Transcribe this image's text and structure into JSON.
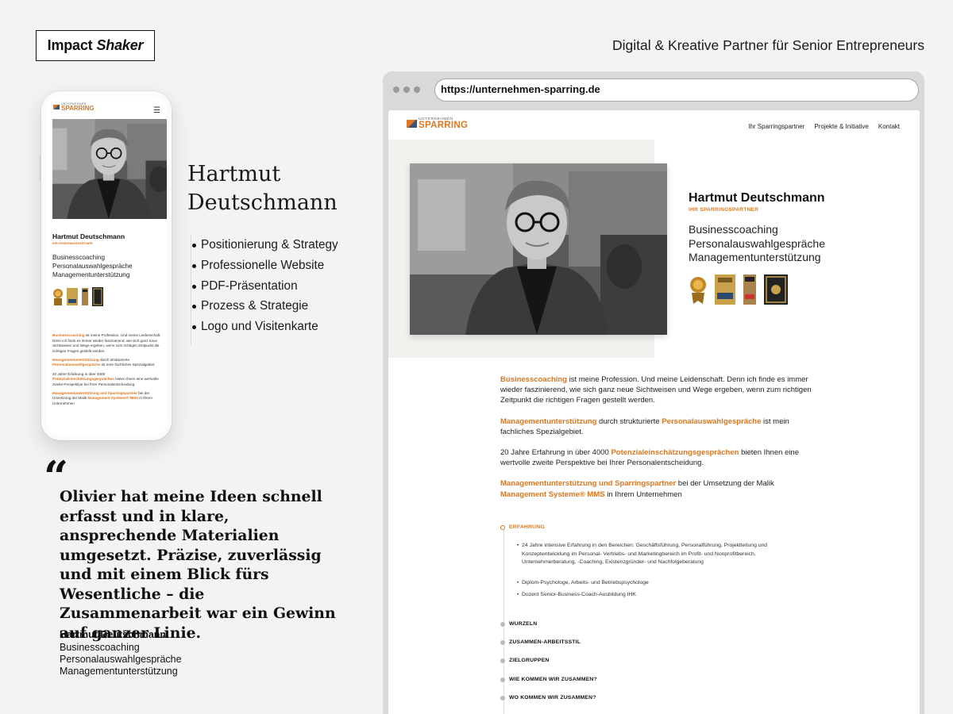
{
  "brand": {
    "name_regular": "Impact",
    "name_italic": "Shaker"
  },
  "tagline": "Digital & Kreative Partner für Senior Entrepreneurs",
  "client": {
    "name_line1": "Hartmut",
    "name_line2": "Deutschmann",
    "full_name": "Hartmut Deutschmann",
    "role": "IHR SPARRINGSPARTNER",
    "services": [
      "Businesscoaching",
      "Personalauswahlgespräche",
      "Managementunterstützung"
    ]
  },
  "deliverables": [
    "Positionierung & Strategy",
    "Professionelle Website",
    "PDF-Präsentation",
    "Prozess & Strategie",
    "Logo und Visitenkarte"
  ],
  "testimonial": {
    "quote": "Olivier hat meine Ideen schnell erfasst und in klare, ansprechende Materialien umgesetzt. Präzise, zuverlässig und mit einem Blick fürs Wesentliche – die Zusammenarbeit war ein Gewinn auf ganzer Linie.",
    "author": "Hartmut Deutschmann",
    "author_lines": [
      "Businesscoaching",
      "Personalauswahlgespräche",
      "Managementunterstützung"
    ]
  },
  "browser": {
    "url": "https://unternehmen-sparring.de"
  },
  "site": {
    "logo_small": "UNTERNEHMEN",
    "logo_big": "SPARRING",
    "nav": [
      "Ihr Sparringspartner",
      "Projekte & Initiative",
      "Kontakt"
    ],
    "p1_hl": "Businesscoaching",
    "p1_rest": " ist meine Profession. Und meine Leidenschaft. Denn ich finde es immer wieder faszinierend, wie sich ganz neue Sichtweisen und Wege ergeben, wenn zum richtigen Zeitpunkt die richtigen Fragen gestellt werden.",
    "p2_hl1": "Managementunterstützung",
    "p2_mid": " durch strukturierte ",
    "p2_hl2": "Personalauswahlgespräche",
    "p2_rest": " ist mein fachliches Spezialgebiet.",
    "p3_a": "20 Jahre Erfahrung in über 4000 ",
    "p3_hl": "Potenzialeinschätzungsgesprächen",
    "p3_rest": " bieten Ihnen eine wertvolle zweite Perspektive bei Ihrer Personalentscheidung.",
    "p4_hl": "Managementunterstützung und Sparringspartner",
    "p4_mid": " bei der Umsetzung der Malik ",
    "p4_hl2": "Management Systeme® MMS",
    "p4_rest": " in Ihrem Unternehmen",
    "accordion_open": "ERFAHRUNG",
    "experience": [
      "24 Jahre intensive Erfahrung in den Bereichen: Geschäftsführung, Personalführung, Projektleitung und Konzeptentwicklung im  Personal- Vertriebs- und Marketingbereich im Profit- und Nonprofitbereich, Unternehmerberatung, -Coaching, Existenzgründer- und Nachfolgeberatung",
      "Diplom-Psychologe, Arbeits- und Betriebspsychologe",
      "Dozent Senior-Business-Coach-Ausbildung IHK"
    ],
    "accordion_closed": [
      "WURZELN",
      "ZUSAMMEN-ARBEITSSTIL",
      "ZIELGRUPPEN",
      "WIE KOMMEN WIR ZUSAMMEN?",
      "WO KOMMEN WIR ZUSAMMEN?"
    ]
  },
  "colors": {
    "accent": "#e0761f",
    "navy": "#3b5475",
    "background": "#f3f3f3"
  }
}
